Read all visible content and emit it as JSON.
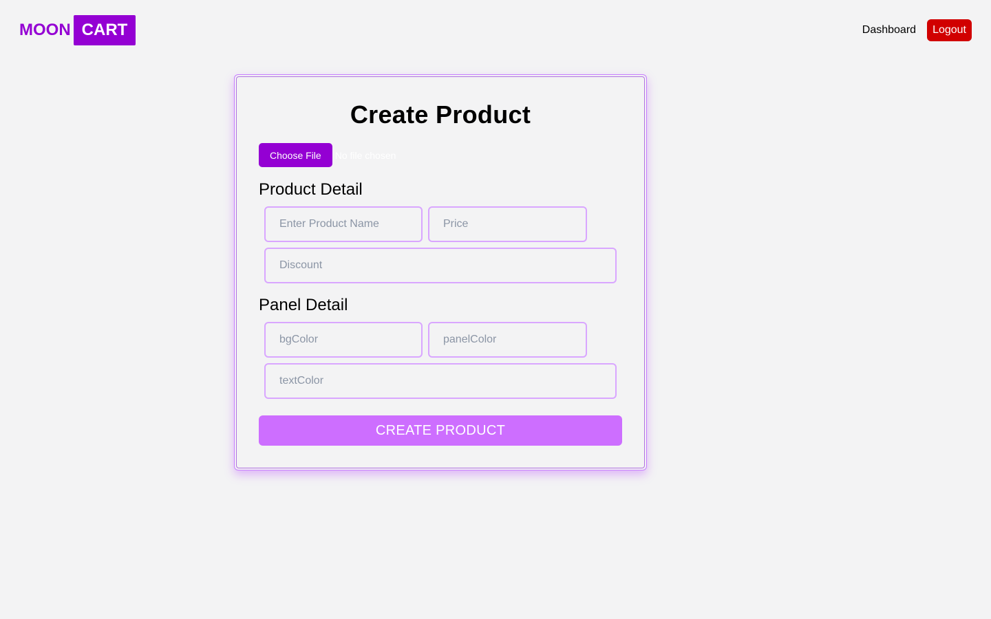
{
  "brand": {
    "part1": "MOON",
    "part2": "CART"
  },
  "nav": {
    "dashboard_label": "Dashboard",
    "logout_label": "Logout"
  },
  "form": {
    "title": "Create Product",
    "file": {
      "button_label": "Choose File",
      "status": "No file chosen"
    },
    "product_section": {
      "label": "Product Detail",
      "name_placeholder": "Enter Product Name",
      "price_placeholder": "Price",
      "discount_placeholder": "Discount"
    },
    "panel_section": {
      "label": "Panel Detail",
      "bgcolor_placeholder": "bgColor",
      "panelcolor_placeholder": "panelColor",
      "textcolor_placeholder": "textColor"
    },
    "submit_label": "CREATE PRODUCT"
  },
  "colors": {
    "brand_purple": "#9400d3",
    "logout_red": "#d10000",
    "submit_purple": "#cd6eff",
    "field_border": "#d9a6ff",
    "page_bg": "#f3f3f4"
  }
}
